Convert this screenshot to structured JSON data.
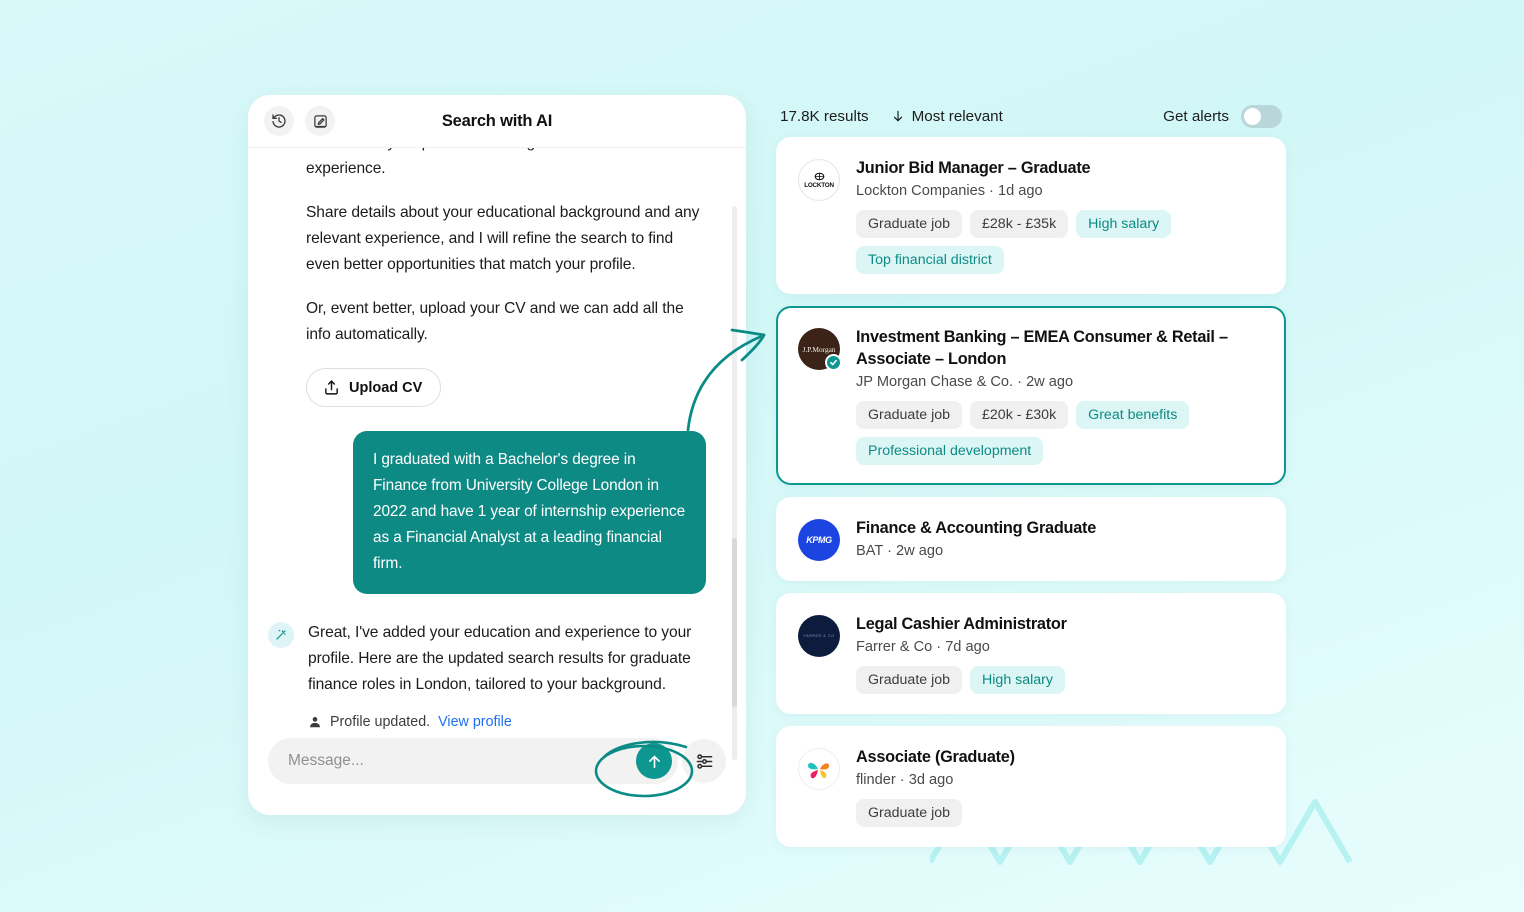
{
  "chat": {
    "title": "Search with AI",
    "history_icon": "history-icon",
    "compose_icon": "compose-icon",
    "messages": [
      {
        "id": "m1",
        "text": "I've noticed your profile is missing education and experience."
      },
      {
        "id": "m2",
        "text": "Share details about your educational background and any relevant experience, and I will refine the search to find even better opportunities that match your profile."
      },
      {
        "id": "m3",
        "text": "Or, event better, upload your CV and we can add all the info automatically."
      }
    ],
    "upload_button": "Upload CV",
    "user_message": "I graduated with a Bachelor's degree in Finance from University College London in 2022 and have 1 year of internship experience as a Financial Analyst at a leading financial firm.",
    "ai_reply": "Great, I've added your education and experience to your profile. Here are the updated search results for graduate finance roles in London, tailored to your background.",
    "profile_status": "Profile updated.",
    "profile_link": "View profile",
    "composer": {
      "placeholder": "Message...",
      "value": "",
      "send_icon": "arrow-up-icon",
      "settings_icon": "sliders-icon"
    },
    "bubble_color": "#0e8a85",
    "send_color": "#0e9690"
  },
  "results": {
    "count_label": "17.8K results",
    "sort_label": "Most relevant",
    "sort_icon": "arrow-down-icon",
    "alerts_label": "Get alerts",
    "alerts_on": false,
    "jobs": [
      {
        "title": "Junior Bid Manager – Graduate",
        "meta": "Lockton Companies · 1d ago",
        "company_short": "LOCKTON",
        "logo_kind": "lockton",
        "verified": false,
        "selected": false,
        "tags": [
          {
            "label": "Graduate job",
            "style": "gray"
          },
          {
            "label": "£28k - £35k",
            "style": "gray"
          },
          {
            "label": "High salary",
            "style": "teal"
          },
          {
            "label": "Top financial district",
            "style": "teal"
          }
        ]
      },
      {
        "title": "Investment Banking – EMEA Consumer & Retail – Associate – London",
        "meta": "JP Morgan Chase & Co. · 2w ago",
        "company_short": "J.P.Morgan",
        "logo_kind": "jpmorgan",
        "verified": true,
        "selected": true,
        "tags": [
          {
            "label": "Graduate job",
            "style": "gray"
          },
          {
            "label": "£20k - £30k",
            "style": "gray"
          },
          {
            "label": "Great benefits",
            "style": "teal"
          },
          {
            "label": "Professional development",
            "style": "teal"
          }
        ]
      },
      {
        "title": "Finance & Accounting Graduate",
        "meta": "BAT · 2w ago",
        "company_short": "KPMG",
        "logo_kind": "kpmg",
        "verified": false,
        "selected": false,
        "tags": []
      },
      {
        "title": "Legal Cashier Administrator",
        "meta": "Farrer & Co · 7d ago",
        "company_short": "FARRER & CO",
        "logo_kind": "farrer",
        "verified": false,
        "selected": false,
        "tags": [
          {
            "label": "Graduate job",
            "style": "gray"
          },
          {
            "label": "High salary",
            "style": "teal"
          }
        ]
      },
      {
        "title": "Associate (Graduate)",
        "meta": "flinder · 3d ago",
        "company_short": "flinder",
        "logo_kind": "flinder",
        "verified": false,
        "selected": false,
        "tags": [
          {
            "label": "Graduate job",
            "style": "gray"
          }
        ]
      }
    ]
  },
  "annotations": {
    "arrow": "curved-arrow-annotation",
    "ellipse": "ellipse-highlight-annotation",
    "color": "#0b8b86"
  }
}
